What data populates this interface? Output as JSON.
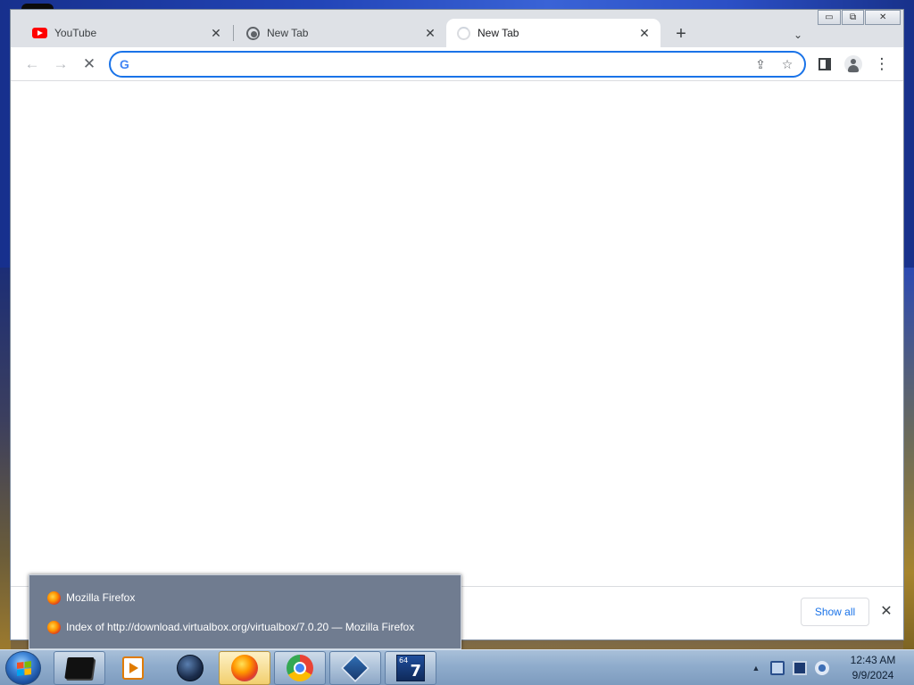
{
  "browser": {
    "tabs": [
      {
        "title": "YouTube",
        "icon": "youtube-icon",
        "active": false
      },
      {
        "title": "New Tab",
        "icon": "chrome-icon",
        "active": false
      },
      {
        "title": "New Tab",
        "icon": "loading-spinner-icon",
        "active": true
      }
    ],
    "new_tab_symbol": "+",
    "tab_search_symbol": "⌄",
    "close_symbol": "✕",
    "window_controls": {
      "minimize": "▭",
      "restore": "⧉",
      "close": "✕"
    },
    "toolbar": {
      "back_symbol": "←",
      "forward_symbol": "→",
      "stop_symbol": "✕",
      "omnibox_logo": "G",
      "omnibox_value": "",
      "share_symbol": "⇪",
      "bookmark_symbol": "☆",
      "menu_symbol": "⋮"
    },
    "download_shelf": {
      "show_all_label": "Show all",
      "close_symbol": "✕"
    }
  },
  "taskbar_popup": {
    "app_title": "Mozilla Firefox",
    "window_title": "Index of http://download.virtualbox.org/virtualbox/7.0.20 — Mozilla Firefox"
  },
  "taskbar": {
    "apps": [
      "command-prompt",
      "media-player",
      "network-globe",
      "firefox",
      "chrome",
      "virtualbox",
      "seven-zip"
    ],
    "tray_expand_symbol": "▲",
    "seven_zip_labels": {
      "bits": "64",
      "number": "7"
    },
    "clock": {
      "time": "12:43 AM",
      "date": "9/9/2024"
    }
  },
  "colors": {
    "accent": "#1a73e8",
    "tabstrip_bg": "#dee1e6",
    "popup_bg": "#707c90",
    "taskbar_bg": "#8faccc"
  }
}
